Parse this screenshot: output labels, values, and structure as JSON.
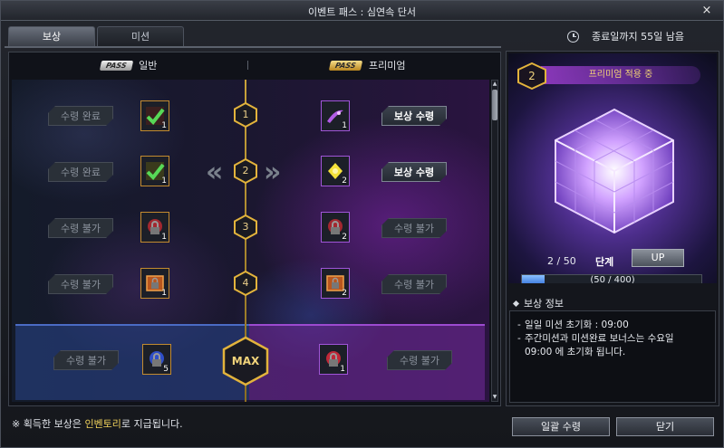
{
  "window": {
    "title": "이벤트 패스 : 심연속 단서",
    "close": "×"
  },
  "tabs": [
    {
      "label": "보상",
      "active": true
    },
    {
      "label": "미션",
      "active": false
    }
  ],
  "deadline": {
    "text": "종료일까지 55일 남음",
    "icon": "clock-icon"
  },
  "columns": {
    "normal": {
      "pass_tag": "PASS",
      "label": "일반"
    },
    "premium": {
      "pass_tag": "PASS",
      "label": "프리미엄"
    }
  },
  "rows": [
    {
      "level": "1",
      "normal_status": "수령 완료",
      "normal_count": "1",
      "normal_icon": "check-icon",
      "premium_action": "보상 수령",
      "premium_count": "1",
      "premium_icon": "purple-feather-icon"
    },
    {
      "level": "2",
      "normal_status": "수령 완료",
      "normal_count": "1",
      "normal_icon": "check-icon",
      "premium_action": "보상 수령",
      "premium_count": "2",
      "premium_icon": "yellow-gem-icon"
    },
    {
      "level": "3",
      "normal_status": "수령 불가",
      "normal_count": "1",
      "normal_icon": "locked-red-gem-icon",
      "premium_action": "수령 불가",
      "premium_count": "2",
      "premium_icon": "locked-red-gem-icon"
    },
    {
      "level": "4",
      "normal_status": "수령 불가",
      "normal_count": "1",
      "normal_icon": "locked-chest-icon",
      "premium_action": "수령 불가",
      "premium_count": "2",
      "premium_icon": "locked-chest-icon"
    },
    {
      "level": "MAX",
      "normal_status": "수령 불가",
      "normal_count": "5",
      "normal_icon": "locked-blue-orb-icon",
      "premium_action": "수령 불가",
      "premium_count": "1",
      "premium_icon": "locked-red-orb-icon"
    }
  ],
  "stage": {
    "level": "2",
    "premium_status": "프리미엄 적용 중",
    "count": "2 / 50",
    "label": "단계",
    "up_button": "UP",
    "progress_text": "(50 / 400)",
    "progress_fraction": 0.125
  },
  "info": {
    "title": "보상 정보",
    "lines": [
      "일일 미션 초기화 : 09:00",
      "주간미션과 미션완료 보너스는 수요일",
      "09:00 에 초기화 됩니다."
    ]
  },
  "footer": {
    "note_prefix": "※ 획득한 보상은 ",
    "note_highlight": "인벤토리",
    "note_suffix": "로 지급됩니다.",
    "claim_all": "일괄 수령",
    "close": "닫기"
  },
  "colors": {
    "accent_gold": "#c9a23a",
    "premium_purple": "#a055d8",
    "normal_blue": "#4a6bc4"
  }
}
